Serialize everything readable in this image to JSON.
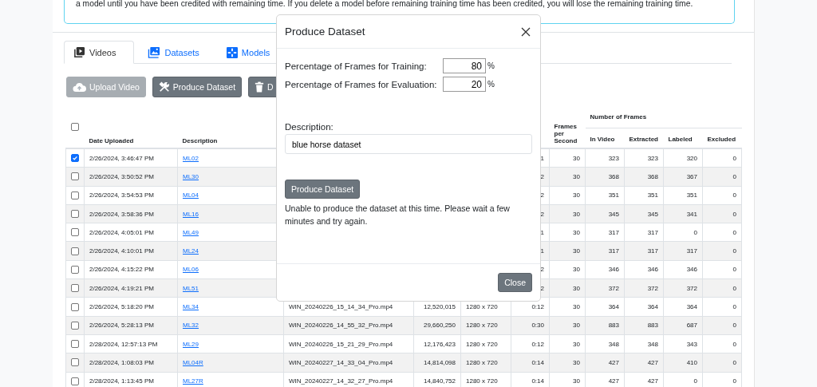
{
  "notice": {
    "text": "a model until you have been credited with remaining time. If you delete a model before remaining training time has been credited, you will lose the remaining training time."
  },
  "tabs": [
    {
      "label": "Videos",
      "selected": true
    },
    {
      "label": "Datasets",
      "selected": false
    },
    {
      "label": "Models",
      "selected": false
    }
  ],
  "toolbar": [
    {
      "label": "Upload Video",
      "disabled": true
    },
    {
      "label": "Produce Dataset",
      "disabled": false
    },
    {
      "label": "D",
      "disabled": false
    }
  ],
  "table": {
    "select_all": {
      "checked": false
    },
    "columns": [
      "Date Uploaded",
      "Description",
      "Frames per Second"
    ],
    "group_header": "Number of Frames",
    "group_columns": [
      "In Video",
      "Extracted",
      "Labeled",
      "Excluded"
    ],
    "rows": [
      {
        "checked": true,
        "date": "2/26/2024, 3:46:47 PM",
        "description": "ML02",
        "duration": "1",
        "fps": "30",
        "in_video": "323",
        "extracted": "323",
        "labeled": "320",
        "excluded": "0"
      },
      {
        "checked": false,
        "date": "2/26/2024, 3:50:52 PM",
        "description": "ML30",
        "duration": "2",
        "fps": "30",
        "in_video": "368",
        "extracted": "368",
        "labeled": "367",
        "excluded": "0"
      },
      {
        "checked": false,
        "date": "2/26/2024, 3:54:53 PM",
        "description": "ML04",
        "duration": "2",
        "fps": "30",
        "in_video": "351",
        "extracted": "351",
        "labeled": "351",
        "excluded": "0"
      },
      {
        "checked": false,
        "date": "2/26/2024, 3:58:36 PM",
        "description": "ML16",
        "duration": "2",
        "fps": "30",
        "in_video": "345",
        "extracted": "345",
        "labeled": "341",
        "excluded": "0"
      },
      {
        "checked": false,
        "date": "2/26/2024, 4:05:01 PM",
        "description": "ML49",
        "duration": "1",
        "fps": "30",
        "in_video": "317",
        "extracted": "317",
        "labeled": "0",
        "excluded": "0"
      },
      {
        "checked": false,
        "date": "2/26/2024, 4:10:01 PM",
        "description": "ML24",
        "duration": "1",
        "fps": "30",
        "in_video": "317",
        "extracted": "317",
        "labeled": "317",
        "excluded": "0"
      },
      {
        "checked": false,
        "date": "2/26/2024, 4:15:22 PM",
        "description": "ML06",
        "duration": "2",
        "fps": "30",
        "in_video": "346",
        "extracted": "346",
        "labeled": "346",
        "excluded": "0"
      },
      {
        "checked": false,
        "date": "2/26/2024, 4:19:21 PM",
        "description": "ML51",
        "duration": "2",
        "fps": "30",
        "in_video": "372",
        "extracted": "372",
        "labeled": "372",
        "excluded": "0"
      },
      {
        "checked": false,
        "date": "2/26/2024, 5:18:20 PM",
        "description": "ML34",
        "file": "WIN_20240226_15_14_34_Pro.mp4",
        "size": "12,520,015",
        "resolution": "1280 x 720",
        "duration": "0:12",
        "fps": "30",
        "in_video": "364",
        "extracted": "364",
        "labeled": "364",
        "excluded": "0"
      },
      {
        "checked": false,
        "date": "2/26/2024, 5:28:13 PM",
        "description": "ML32",
        "file": "WIN_20240226_14_55_32_Pro.mp4",
        "size": "29,660,250",
        "resolution": "1280 x 720",
        "duration": "0:30",
        "fps": "30",
        "in_video": "883",
        "extracted": "883",
        "labeled": "687",
        "excluded": "0"
      },
      {
        "checked": false,
        "date": "2/28/2024, 12:57:13 PM",
        "description": "ML29",
        "file": "WIN_20240226_15_21_29_Pro.mp4",
        "size": "12,176,423",
        "resolution": "1280 x 720",
        "duration": "0:12",
        "fps": "30",
        "in_video": "348",
        "extracted": "348",
        "labeled": "343",
        "excluded": "0"
      },
      {
        "checked": false,
        "date": "2/28/2024, 1:08:03 PM",
        "description": "ML04R",
        "file": "WIN_20240227_14_33_04_Pro.mp4",
        "size": "14,814,098",
        "resolution": "1280 x 720",
        "duration": "0:14",
        "fps": "30",
        "in_video": "427",
        "extracted": "427",
        "labeled": "410",
        "excluded": "0"
      },
      {
        "checked": false,
        "date": "2/28/2024, 1:13:45 PM",
        "description": "ML27R",
        "file": "WIN_20240227_14_32_27_Pro.mp4",
        "size": "14,840,752",
        "resolution": "1280 x 720",
        "duration": "0:14",
        "fps": "30",
        "in_video": "427",
        "extracted": "427",
        "labeled": "0",
        "excluded": "0"
      }
    ]
  },
  "dialog": {
    "title": "Produce Dataset",
    "fields": [
      {
        "label": "Percentage of Frames for Training:",
        "value": "80",
        "unit": "%"
      },
      {
        "label": "Percentage of Frames for Evaluation:",
        "value": "20",
        "unit": "%"
      }
    ],
    "description_label": "Description:",
    "description_value": "blue horse dataset",
    "action": "Produce Dataset",
    "message": "Unable to produce the dataset at this time. Please wait a few minutes and try again.",
    "close": "Close"
  }
}
